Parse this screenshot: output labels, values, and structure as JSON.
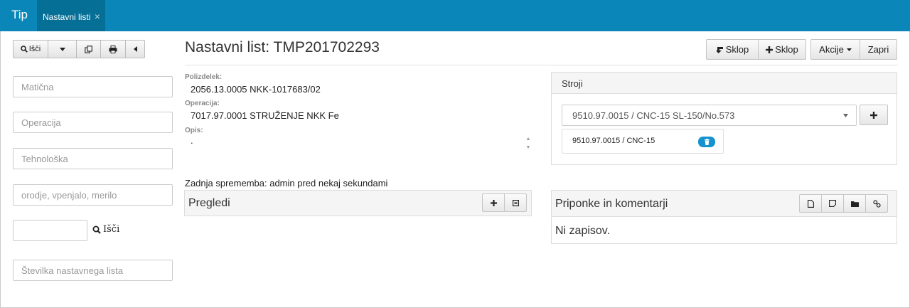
{
  "header": {
    "brand": "Tip",
    "tab_label": "Nastavni listi",
    "tab_close": "×"
  },
  "left_toolbar": {
    "search_label": "Išči"
  },
  "filters": {
    "maticna_placeholder": "Matična",
    "operacija_placeholder": "Operacija",
    "tehnoloska_placeholder": "Tehnološka",
    "orodje_placeholder": "orodje, vpenjalo, merilo",
    "search_button_label": "Išči",
    "stevilka_placeholder": "Številka nastavnega lista"
  },
  "main": {
    "title": "Nastavni list: TMP201702293",
    "actions": {
      "sklop_down": "Sklop",
      "sklop_add": "Sklop",
      "akcije": "Akcije",
      "zapri": "Zapri"
    },
    "polizdelek_label": "Polizdelek:",
    "polizdelek_value": "2056.13.0005 NKK-1017683/02",
    "operacija_label": "Operacija:",
    "operacija_value": "7017.97.0001 STRUŽENJE NKK Fe",
    "opis_label": "Opis:",
    "opis_value": ".",
    "last_change": "Zadnja sprememba: admin pred nekaj sekundami"
  },
  "stroji": {
    "title": "Stroji",
    "selected": "9510.97.0015 / CNC-15 SL-150/No.573",
    "chip": "9510.97.0015 / CNC-15"
  },
  "pregledi": {
    "title": "Pregledi"
  },
  "priponke": {
    "title": "Priponke in komentarji",
    "empty": "Ni zapisov."
  },
  "colors": {
    "topbar": "#0a87b8",
    "tab_active": "#066f96",
    "chip_badge": "#1593cf"
  }
}
